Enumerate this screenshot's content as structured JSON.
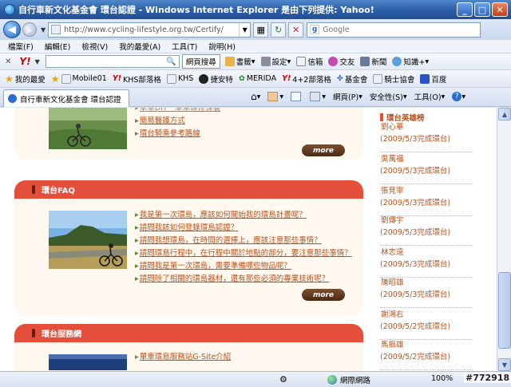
{
  "window": {
    "title": "自行車新文化基金會 環台認證 - Windows Internet Explorer 是由下列提供: Yahoo!",
    "buttons": {
      "minimize": "_",
      "maximize": "□",
      "close": "✕"
    }
  },
  "address_bar": {
    "url": "http://www.cycling-lifestyle.org.tw/Certify/",
    "search_placeholder": "Google"
  },
  "menu": [
    "檔案(F)",
    "編輯(E)",
    "檢視(V)",
    "我的最愛(A)",
    "工具(T)",
    "說明(H)"
  ],
  "yahoo_toolbar": {
    "close": "✕",
    "logo": "Y!",
    "search_button": "網頁搜尋",
    "items": [
      "書籤",
      "設定",
      "信箱",
      "交友",
      "新聞",
      "知識+"
    ]
  },
  "favorites_bar": {
    "items": [
      "我的最愛",
      "Mobile01",
      "KHS部落格",
      "KHS",
      "捷安特",
      "MERIDA",
      "4+2部落格",
      "基金會",
      "騎士協會",
      "百度"
    ]
  },
  "tab": {
    "label": "自行車新文化基金會 環台認證"
  },
  "commands": [
    "網頁(P)",
    "安全性(S)",
    "工具(O)"
  ],
  "page": {
    "top_panel": {
      "partial_link": "單車DIY一單車維修保養",
      "links": [
        "簡易醫護方式",
        "環台騎乘參考路線"
      ],
      "more": "more"
    },
    "faq_panel": {
      "title": "環台FAQ",
      "links": [
        "我是第一次環島，應該如何開始我的環島計畫呢？",
        "請問我該如何登錄環島認證？",
        "請問我想環島，在時間的選擇上，應該注意那些事情？",
        "請問環島行程中，在行程中關於地點的部分，要注意那些事情？",
        "請問我是第一次環島，需要準備哪些物品呢？",
        "請問除了相關的環島器材，還有那些必須的專業技術呢？"
      ],
      "more": "more"
    },
    "service_panel": {
      "title": "環台服務網",
      "links": [
        "單車環島服務站G-Site介紹"
      ]
    }
  },
  "sidebar": {
    "title": "環台英雄榜",
    "heroes": [
      {
        "name": "劉心華",
        "date": "(2009/5/3完成環台)"
      },
      {
        "name": "吳萬福",
        "date": "(2009/5/3完成環台)"
      },
      {
        "name": "張見宰",
        "date": "(2009/5/3完成環台)"
      },
      {
        "name": "劉傳宇",
        "date": "(2009/5/3完成環台)"
      },
      {
        "name": "林志遠",
        "date": "(2009/5/3完成環台)"
      },
      {
        "name": "陳昭雄",
        "date": "(2009/5/3完成環台)"
      },
      {
        "name": "謝鴻右",
        "date": "(2009/5/2完成環台)"
      },
      {
        "name": "馬振雄",
        "date": "(2009/5/2完成環台)"
      }
    ]
  },
  "status_bar": {
    "zone": "網際網路",
    "zoom": "100%"
  },
  "watermark": "#772918"
}
